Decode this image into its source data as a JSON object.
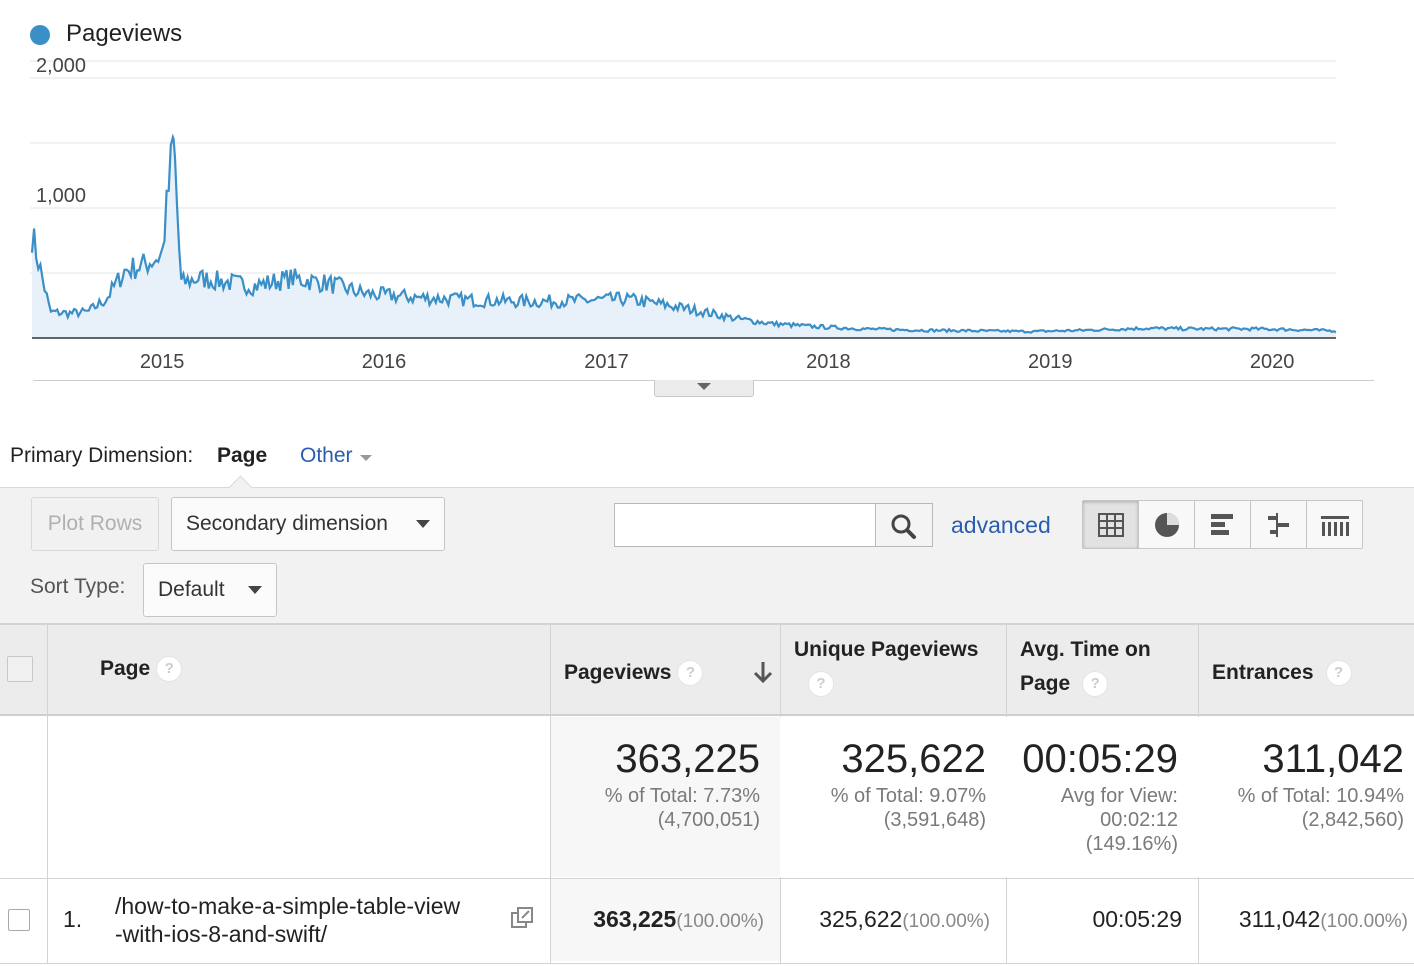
{
  "chart": {
    "legend_label": "Pageviews",
    "series_color": "#3a8fc7",
    "y_ticks": [
      "2,000",
      "1,000"
    ],
    "x_ticks": [
      "2015",
      "2016",
      "2017",
      "2018",
      "2019",
      "2020"
    ]
  },
  "chart_data": {
    "type": "area",
    "title": "",
    "series": [
      {
        "name": "Pageviews",
        "color": "#3a8fc7"
      }
    ],
    "x_range": [
      "2014-06-01",
      "2020-04-15"
    ],
    "ylim": [
      0,
      2000
    ],
    "grid": true,
    "legend_position": "top-left",
    "x": [
      "2014-06-01",
      "2014-07-01",
      "2014-08-01",
      "2014-09-01",
      "2014-10-01",
      "2014-11-01",
      "2014-12-01",
      "2015-01-01",
      "2015-01-20",
      "2015-02-01",
      "2015-03-01",
      "2015-04-01",
      "2015-06-01",
      "2015-08-01",
      "2015-10-01",
      "2015-12-01",
      "2016-03-01",
      "2016-06-01",
      "2016-09-01",
      "2016-12-01",
      "2017-02-01",
      "2017-04-01",
      "2017-06-01",
      "2017-08-01",
      "2017-10-01",
      "2017-12-01",
      "2018-03-01",
      "2018-06-01",
      "2018-09-01",
      "2018-12-01",
      "2019-03-01",
      "2019-06-01",
      "2019-09-01",
      "2019-12-01",
      "2020-02-01",
      "2020-04-15"
    ],
    "values": [
      800,
      200,
      190,
      200,
      300,
      520,
      560,
      640,
      1530,
      420,
      460,
      440,
      400,
      460,
      420,
      340,
      310,
      290,
      280,
      290,
      300,
      260,
      210,
      150,
      110,
      90,
      70,
      60,
      55,
      50,
      60,
      75,
      70,
      70,
      65,
      55
    ]
  },
  "primary_dimension": {
    "label": "Primary Dimension:",
    "selected": "Page",
    "other": "Other"
  },
  "toolbar": {
    "plot_rows": "Plot Rows",
    "secondary_dimension": "Secondary dimension",
    "sort_type_label": "Sort Type:",
    "sort_type_value": "Default",
    "search_value": "",
    "advanced": "advanced",
    "view_buttons": [
      "data-table",
      "percentage",
      "performance",
      "comparison",
      "term-cloud"
    ]
  },
  "table": {
    "columns": {
      "page": "Page",
      "pageviews": "Pageviews",
      "unique_pageviews": "Unique Pageviews",
      "avg_time_line1": "Avg. Time on",
      "avg_time_line2": "Page",
      "entrances": "Entrances"
    },
    "help_glyph": "?",
    "totals": {
      "pageviews": "363,225",
      "pageviews_pct": "% of Total: 7.73%",
      "pageviews_total": "(4,700,051)",
      "unique_pageviews": "325,622",
      "unique_pageviews_pct": "% of Total: 9.07%",
      "unique_pageviews_total": "(3,591,648)",
      "avg_time": "00:05:29",
      "avg_time_line1": "Avg for View:",
      "avg_time_line2": "00:02:12",
      "avg_time_line3": "(149.16%)",
      "entrances": "311,042",
      "entrances_pct": "% of Total: 10.94%",
      "entrances_total": "(2,842,560)"
    },
    "rows": [
      {
        "index": "1.",
        "page_line1": "/how-to-make-a-simple-table-view",
        "page_line2": "-with-ios-8-and-swift/",
        "pageviews": "363,225",
        "pageviews_pct": "(100.00%)",
        "unique_pageviews": "325,622",
        "unique_pageviews_pct": "(100.00%)",
        "avg_time": "00:05:29",
        "entrances": "311,042",
        "entrances_pct": "(100.00%)"
      }
    ]
  }
}
